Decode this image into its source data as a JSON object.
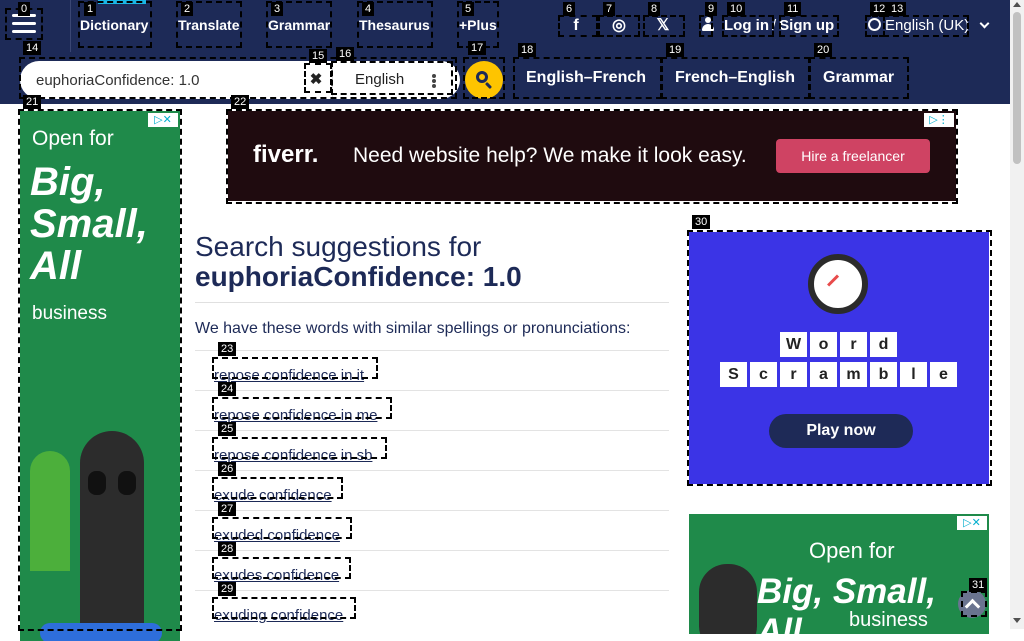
{
  "nav": {
    "menu_icon": "hamburger-icon",
    "links": [
      "Dictionary",
      "Translate",
      "Grammar",
      "Thesaurus",
      "+Plus"
    ]
  },
  "social": {
    "facebook": "f",
    "instagram": "◎",
    "x": "𝕏"
  },
  "account": {
    "login": "Log in",
    "sep": "/",
    "signup": "Sign up"
  },
  "language": {
    "label": "English (UK)"
  },
  "search": {
    "value": "euphoriaConfidence: 1.0",
    "clear_icon": "✖",
    "lang_label": "English"
  },
  "dictionaries": [
    "English–French",
    "French–English",
    "Grammar"
  ],
  "ads": {
    "left": {
      "line1": "Open for",
      "line2": "Big, Small, All",
      "line3": "business"
    },
    "top": {
      "logo": "fiverr.",
      "text": "Need website help? We make it look easy.",
      "cta": "Hire a freelancer"
    },
    "right": {
      "letters1": [
        "W",
        "o",
        "r",
        "d"
      ],
      "letters2": [
        "S",
        "c",
        "r",
        "a",
        "m",
        "b",
        "l",
        "e"
      ],
      "cta": "Play now"
    },
    "right2": {
      "line1": "Open for",
      "line2": "Big, Small, All",
      "line3": "business"
    }
  },
  "results": {
    "heading": "Search suggestions for",
    "query": "euphoriaConfidence: 1.0",
    "intro": "We have these words with similar spellings or pronunciations:",
    "suggestions": [
      "repose confidence in it",
      "repose confidence in me",
      "repose confidence in sb",
      "exude confidence",
      "exuded confidence",
      "exudes confidence",
      "exuding confidence"
    ]
  },
  "labels": [
    "0",
    "1",
    "2",
    "3",
    "4",
    "5",
    "6",
    "7",
    "8",
    "9",
    "10",
    "11",
    "12",
    "13",
    "14",
    "15",
    "16",
    "17",
    "18",
    "19",
    "20",
    "21",
    "22",
    "23",
    "24",
    "25",
    "26",
    "27",
    "28",
    "29",
    "30",
    "31"
  ]
}
